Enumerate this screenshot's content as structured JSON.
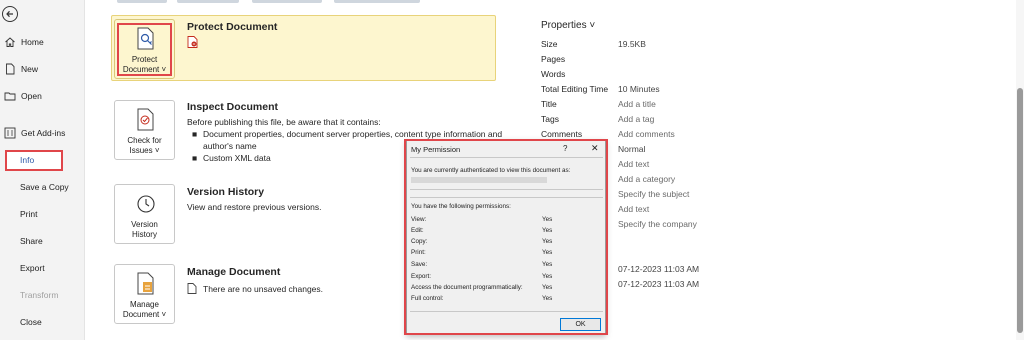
{
  "sidebar": {
    "items": [
      {
        "label": "Home",
        "icon": "home-icon"
      },
      {
        "label": "New",
        "icon": "new-document-icon"
      },
      {
        "label": "Open",
        "icon": "folder-open-icon"
      },
      {
        "label": "Get Add-ins",
        "icon": "add-ins-icon"
      },
      {
        "label": "Info"
      },
      {
        "label": "Save a Copy"
      },
      {
        "label": "Print"
      },
      {
        "label": "Share"
      },
      {
        "label": "Export"
      },
      {
        "label": "Transform"
      },
      {
        "label": "Close"
      }
    ]
  },
  "protect": {
    "button_line1": "Protect",
    "button_line2": "Document",
    "chevron": "˅",
    "title": "Protect Document"
  },
  "inspect": {
    "button_line1": "Check for",
    "button_line2": "Issues",
    "chevron": "˅",
    "title": "Inspect Document",
    "description": "Before publishing this file, be aware that it contains:",
    "bullets": [
      "Document properties, document server properties, content type information and",
      "author's name",
      "Custom XML data"
    ]
  },
  "version": {
    "button_line1": "Version",
    "button_line2": "History",
    "title": "Version History",
    "description": "View and restore previous versions."
  },
  "manage": {
    "button_line1": "Manage",
    "button_line2": "Document",
    "chevron": "˅",
    "title": "Manage Document",
    "description": "There are no unsaved changes."
  },
  "properties": {
    "header": "Properties ˅",
    "rows": [
      {
        "label": "Size",
        "value": "19.5KB"
      },
      {
        "label": "Pages",
        "value": ""
      },
      {
        "label": "Words",
        "value": ""
      },
      {
        "label": "Total Editing Time",
        "value": "10 Minutes"
      },
      {
        "label": "Title",
        "value": "Add a title"
      },
      {
        "label": "Tags",
        "value": "Add a tag"
      },
      {
        "label": "Comments",
        "value": "Add comments"
      }
    ],
    "hidden_values": [
      "Normal",
      "Add text",
      "Add a category",
      "Specify the subject",
      "Add text",
      "Specify the company"
    ],
    "dates": [
      "07-12-2023 11:03 AM",
      "07-12-2023 11:03 AM"
    ]
  },
  "dialog": {
    "title": "My Permission",
    "help": "?",
    "close": "✕",
    "auth_text": "You are currently authenticated to view this document as:",
    "perm_header": "You have the following permissions:",
    "permissions": [
      {
        "label": "View:",
        "value": "Yes"
      },
      {
        "label": "Edit:",
        "value": "Yes"
      },
      {
        "label": "Copy:",
        "value": "Yes"
      },
      {
        "label": "Print:",
        "value": "Yes"
      },
      {
        "label": "Save:",
        "value": "Yes"
      },
      {
        "label": "Export:",
        "value": "Yes"
      },
      {
        "label": "Access the document programmatically:",
        "value": "Yes"
      },
      {
        "label": "Full control:",
        "value": "Yes"
      }
    ],
    "ok": "OK"
  },
  "colors": {
    "highlight_red": "#e0464a",
    "protect_bg": "#fdf6cf",
    "info_text": "#2e5aa8"
  }
}
